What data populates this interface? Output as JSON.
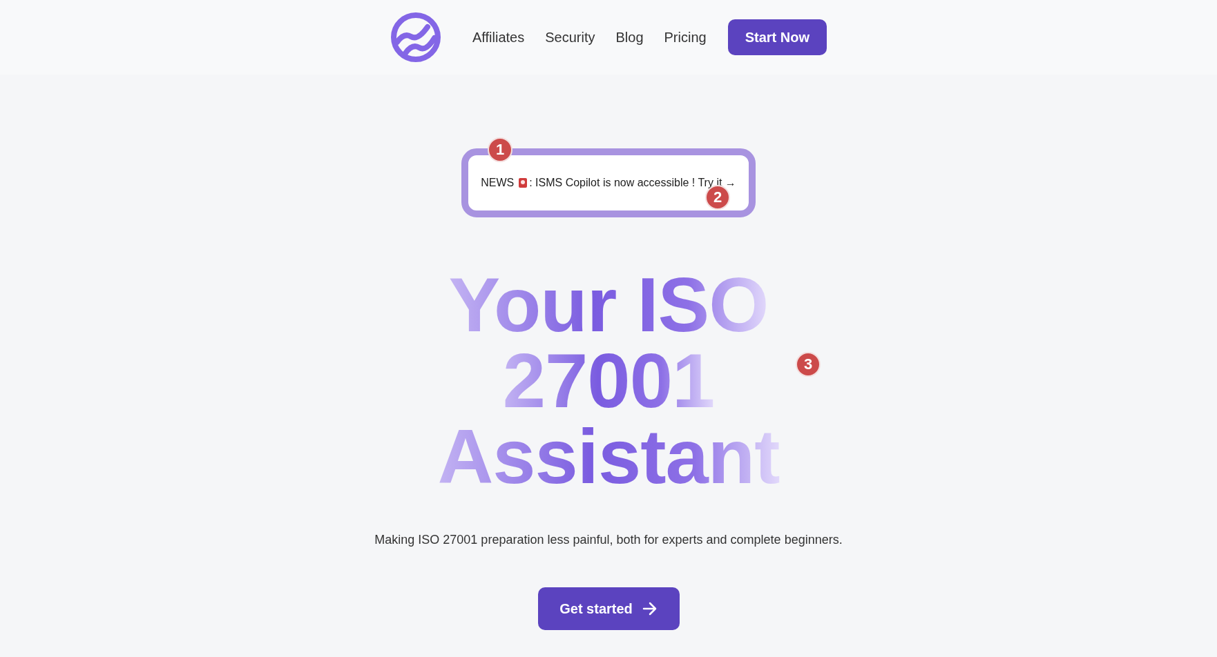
{
  "nav": {
    "links": [
      "Affiliates",
      "Security",
      "Blog",
      "Pricing"
    ],
    "cta": "Start Now"
  },
  "news": {
    "label": "NEWS",
    "text": ": ISMS Copilot is now accessible ! Try it →"
  },
  "hero": {
    "title_lines": [
      "Your ISO",
      "27001",
      "Assistant"
    ],
    "subtitle": "Making ISO 27001 preparation less painful, both for experts and complete beginners.",
    "button": "Get started"
  },
  "markers": [
    {
      "label": "1"
    },
    {
      "label": "2"
    },
    {
      "label": "3"
    }
  ]
}
